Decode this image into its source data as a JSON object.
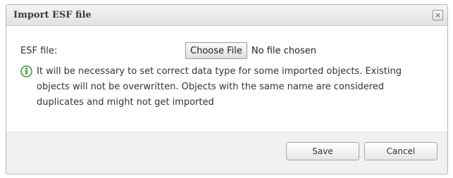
{
  "dialog": {
    "title": "Import ESF file",
    "close_glyph": "×"
  },
  "form": {
    "file_label": "ESF file:",
    "choose_file_label": "Choose File",
    "no_file_text": "No file chosen"
  },
  "info": {
    "icon": "info-person-icon",
    "icon_color": "#2e9a2e",
    "message": "It will be necessary to set correct data type for some imported objects. Existing objects will not be overwritten. Objects with the same name are considered duplicates and might not get imported"
  },
  "footer": {
    "save_label": "Save",
    "cancel_label": "Cancel"
  }
}
